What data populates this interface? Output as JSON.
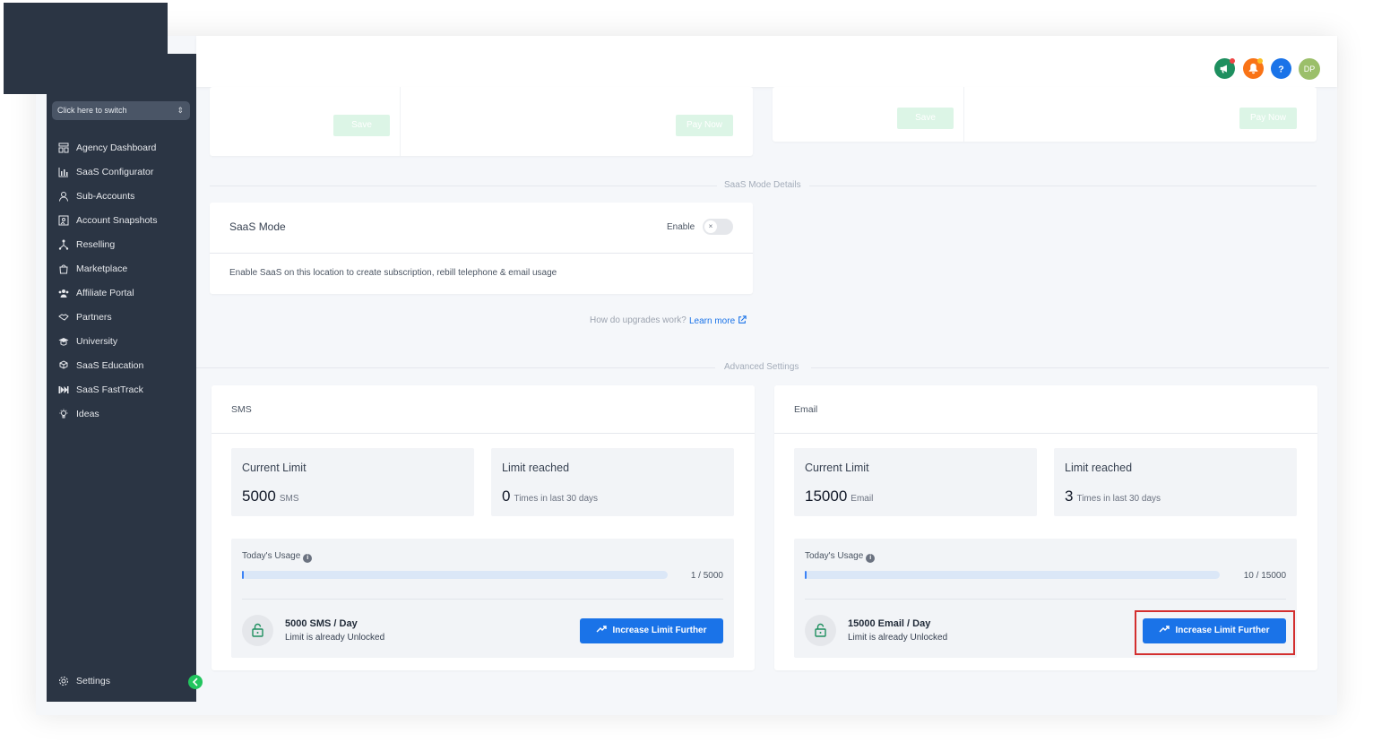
{
  "sidebar": {
    "switcher_label": "Click here to switch",
    "items": [
      {
        "label": "Agency Dashboard",
        "icon": "dashboard-icon"
      },
      {
        "label": "SaaS Configurator",
        "icon": "chart-bar-icon"
      },
      {
        "label": "Sub-Accounts",
        "icon": "user-icon"
      },
      {
        "label": "Account Snapshots",
        "icon": "snapshot-icon"
      },
      {
        "label": "Reselling",
        "icon": "sitemap-icon"
      },
      {
        "label": "Marketplace",
        "icon": "shopping-bag-icon"
      },
      {
        "label": "Affiliate Portal",
        "icon": "users-icon"
      },
      {
        "label": "Partners",
        "icon": "handshake-icon"
      },
      {
        "label": "University",
        "icon": "graduation-cap-icon"
      },
      {
        "label": "SaaS Education",
        "icon": "cubes-icon"
      },
      {
        "label": "SaaS FastTrack",
        "icon": "fast-forward-icon"
      },
      {
        "label": "Ideas",
        "icon": "lightbulb-icon"
      }
    ],
    "settings_label": "Settings"
  },
  "header": {
    "avatar_initials": "DP",
    "icon_colors": {
      "megaphone": "#1e8f5f",
      "bell": "#f97316",
      "help": "#1a73e8"
    }
  },
  "top_cards": {
    "left": {
      "save_label": "Save",
      "pay_label": "Pay Now"
    },
    "right": {
      "save_label": "Save",
      "pay_label": "Pay Now"
    }
  },
  "saas_mode": {
    "section_label": "SaaS Mode Details",
    "title": "SaaS Mode",
    "enable_label": "Enable",
    "toggle_enabled": false,
    "description": "Enable SaaS on this location to create subscription, rebill telephone & email usage",
    "upgrade_question": "How do upgrades work?",
    "learn_more": "Learn more"
  },
  "advanced_settings": {
    "section_label": "Advanced Settings",
    "sms": {
      "title": "SMS",
      "current_limit_label": "Current Limit",
      "current_limit_value": "5000",
      "current_limit_unit": "SMS",
      "limit_reached_label": "Limit reached",
      "limit_reached_value": "0",
      "limit_reached_unit": "Times in last 30 days",
      "usage_label": "Today's Usage",
      "usage_count": "1 / 5000",
      "usage_fraction": 0.0002,
      "limit_title": "5000 SMS / Day",
      "limit_sub": "Limit is already Unlocked",
      "button_label": "Increase Limit Further"
    },
    "email": {
      "title": "Email",
      "current_limit_label": "Current Limit",
      "current_limit_value": "15000",
      "current_limit_unit": "Email",
      "limit_reached_label": "Limit reached",
      "limit_reached_value": "3",
      "limit_reached_unit": "Times in last 30 days",
      "usage_label": "Today's Usage",
      "usage_count": "10 / 15000",
      "usage_fraction": 0.0007,
      "limit_title": "15000 Email / Day",
      "limit_sub": "Limit is already Unlocked",
      "button_label": "Increase Limit Further"
    }
  },
  "colors": {
    "sidebar_bg": "#2b3544",
    "primary": "#1a73e8",
    "highlight": "#d32f2f"
  }
}
